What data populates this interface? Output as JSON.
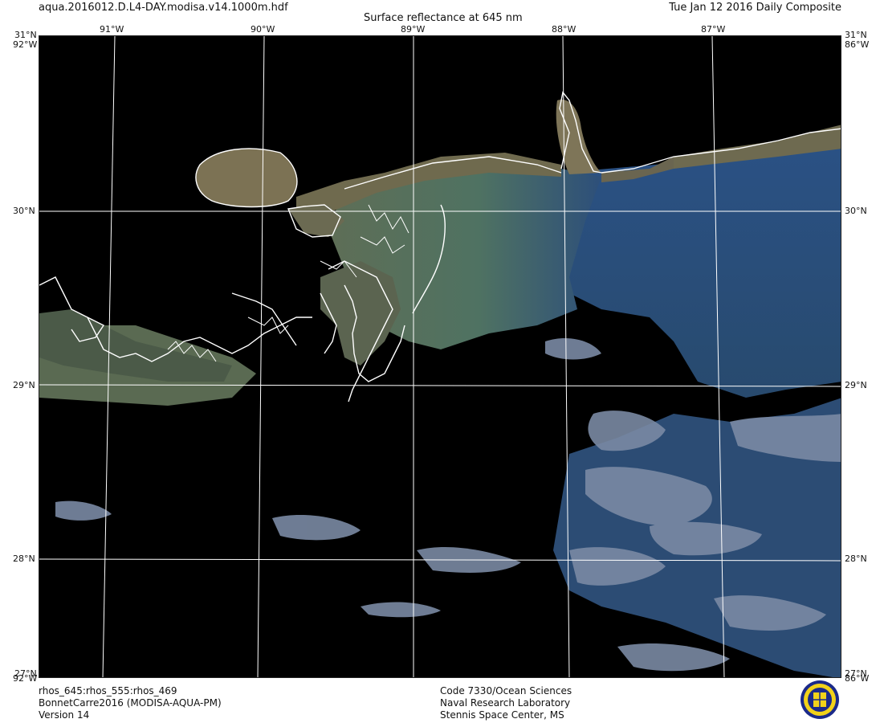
{
  "header": {
    "filename": "aqua.2016012.D.L4-DAY.modisa.v14.1000m.hdf",
    "title": "Surface reflectance at 645 nm",
    "date": "Tue Jan 12 2016 Daily Composite"
  },
  "footer": {
    "left": [
      "rhos_645:rhos_555:rhos_469",
      "BonnetCarre2016 (MODISA-AQUA-PM)",
      "Version 14"
    ],
    "center": [
      "Code 7330/Ocean Sciences",
      "Naval Research Laboratory",
      "Stennis Space Center, MS"
    ]
  },
  "axes": {
    "lon_top": [
      "91°W",
      "90°W",
      "89°W",
      "88°W",
      "87°W"
    ],
    "lat_left": [
      "30°N",
      "29°N",
      "28°N"
    ],
    "lat_right": [
      "30°N",
      "29°N",
      "28°N"
    ],
    "corner_top_left": "31°N",
    "corner_top_left_lon": "92°W",
    "corner_top_right": "31°N",
    "corner_top_right_lon": "86°W",
    "corner_bottom_left": "27°N",
    "corner_bottom_left_lon": "92°W",
    "corner_bottom_right": "27°N",
    "corner_bottom_right_lon": "86°W"
  },
  "colors": {
    "land_sediment": "#7c7254",
    "turbid_water": "#4e6a5a",
    "open_water": "#2f4f78",
    "cloud": "#7a8aa0",
    "background": "#000000",
    "grid": "#ffffff"
  },
  "logo": {
    "name": "nrl-seal-icon"
  }
}
